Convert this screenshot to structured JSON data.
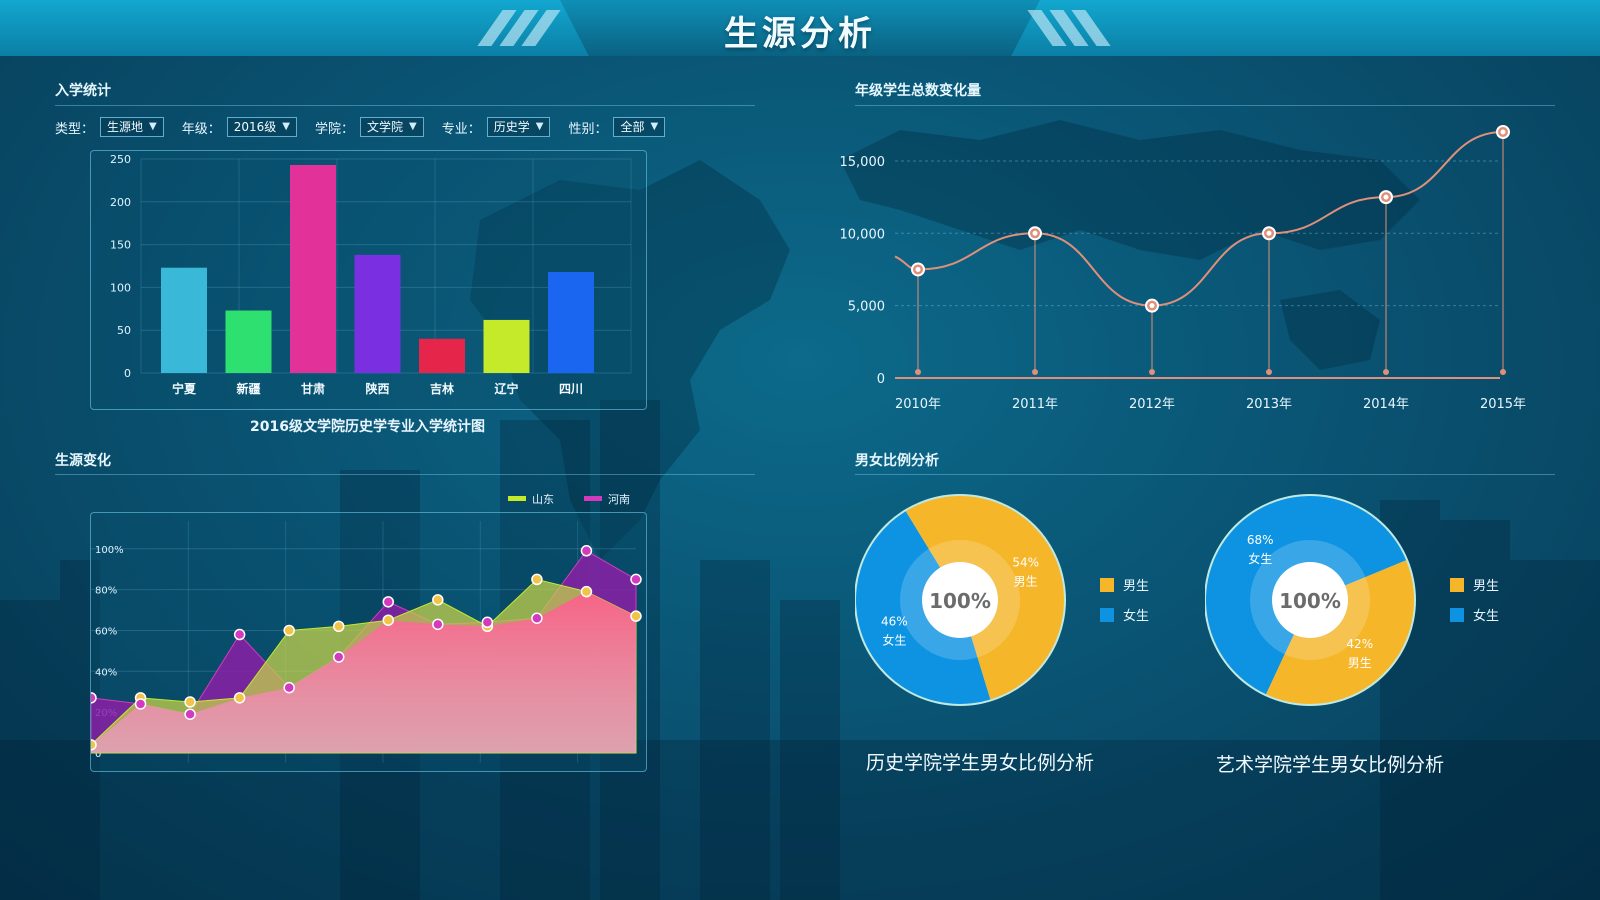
{
  "header": {
    "title": "生源分析"
  },
  "enrollment": {
    "section_title": "入学统计",
    "filters": [
      {
        "label": "类型：",
        "value": "生源地"
      },
      {
        "label": "年级：",
        "value": "2016级"
      },
      {
        "label": "学院：",
        "value": "文学院"
      },
      {
        "label": "专业：",
        "value": "历史学"
      },
      {
        "label": "性别：",
        "value": "全部"
      }
    ],
    "caption": "2016级文学院历史学专业入学统计图"
  },
  "source_change": {
    "section_title": "生源变化"
  },
  "grade_total": {
    "section_title": "年级学生总数变化量"
  },
  "gender": {
    "section_title": "男女比例分析",
    "history_caption": "历史学院学生男女比例分析",
    "art_caption": "艺术学院学生男女比例分析"
  },
  "colors": {
    "accent": "#e0907a",
    "male": "#f6b62a",
    "female": "#0d93e2"
  },
  "chart_data": [
    {
      "id": "enrollment-bar",
      "type": "bar",
      "categories": [
        "宁夏",
        "新疆",
        "甘肃",
        "陕西",
        "吉林",
        "辽宁",
        "四川"
      ],
      "values": [
        123,
        73,
        243,
        138,
        40,
        62,
        118
      ],
      "colors": [
        "#39b8d8",
        "#2ee070",
        "#e3319a",
        "#7a2fe0",
        "#e5264a",
        "#c4ea2a",
        "#1a66f0"
      ],
      "ylim": [
        0,
        250
      ],
      "yticks": [
        "0",
        "50",
        "100",
        "150",
        "200",
        "250"
      ],
      "title": "2016级文学院历史学专业入学统计图",
      "grid": true
    },
    {
      "id": "source-area",
      "type": "area",
      "yticks": [
        "0",
        "20%",
        "40%",
        "60%",
        "80%",
        "100%"
      ],
      "ylim": [
        0,
        100
      ],
      "legend_position": "top-right",
      "series": [
        {
          "name": "山东",
          "color": "#c4ea2a",
          "values": [
            4,
            27,
            25,
            27,
            60,
            62,
            65,
            75,
            62,
            85,
            79,
            67
          ]
        },
        {
          "name": "河南",
          "color": "#d23bbd",
          "values": [
            27,
            24,
            19,
            58,
            32,
            47,
            74,
            63,
            64,
            66,
            99,
            85
          ]
        }
      ],
      "grid": true
    },
    {
      "id": "grade-total-line",
      "type": "line",
      "categories": [
        "2010年",
        "2011年",
        "2012年",
        "2013年",
        "2014年",
        "2015年"
      ],
      "values": [
        7500,
        10000,
        5000,
        10000,
        12500,
        17000
      ],
      "ylim": [
        0,
        17000
      ],
      "yticks": [
        "0",
        "5,000",
        "10,000",
        "15,000"
      ],
      "grid": true
    },
    {
      "id": "history-gender-pie",
      "type": "pie",
      "title": "历史学院学生男女比例分析",
      "center_label": "100%",
      "slices": [
        {
          "name": "男生",
          "value": 54,
          "label": "54%"
        },
        {
          "name": "女生",
          "value": 46,
          "label": "46%"
        }
      ],
      "legend": [
        "男生",
        "女生"
      ]
    },
    {
      "id": "art-gender-pie",
      "type": "pie",
      "title": "艺术学院学生男女比例分析",
      "center_label": "100%",
      "slices": [
        {
          "name": "男生",
          "value": 42,
          "label": "42%"
        },
        {
          "name": "女生",
          "value": 68,
          "label": "68%"
        }
      ],
      "legend": [
        "男生",
        "女生"
      ]
    }
  ]
}
